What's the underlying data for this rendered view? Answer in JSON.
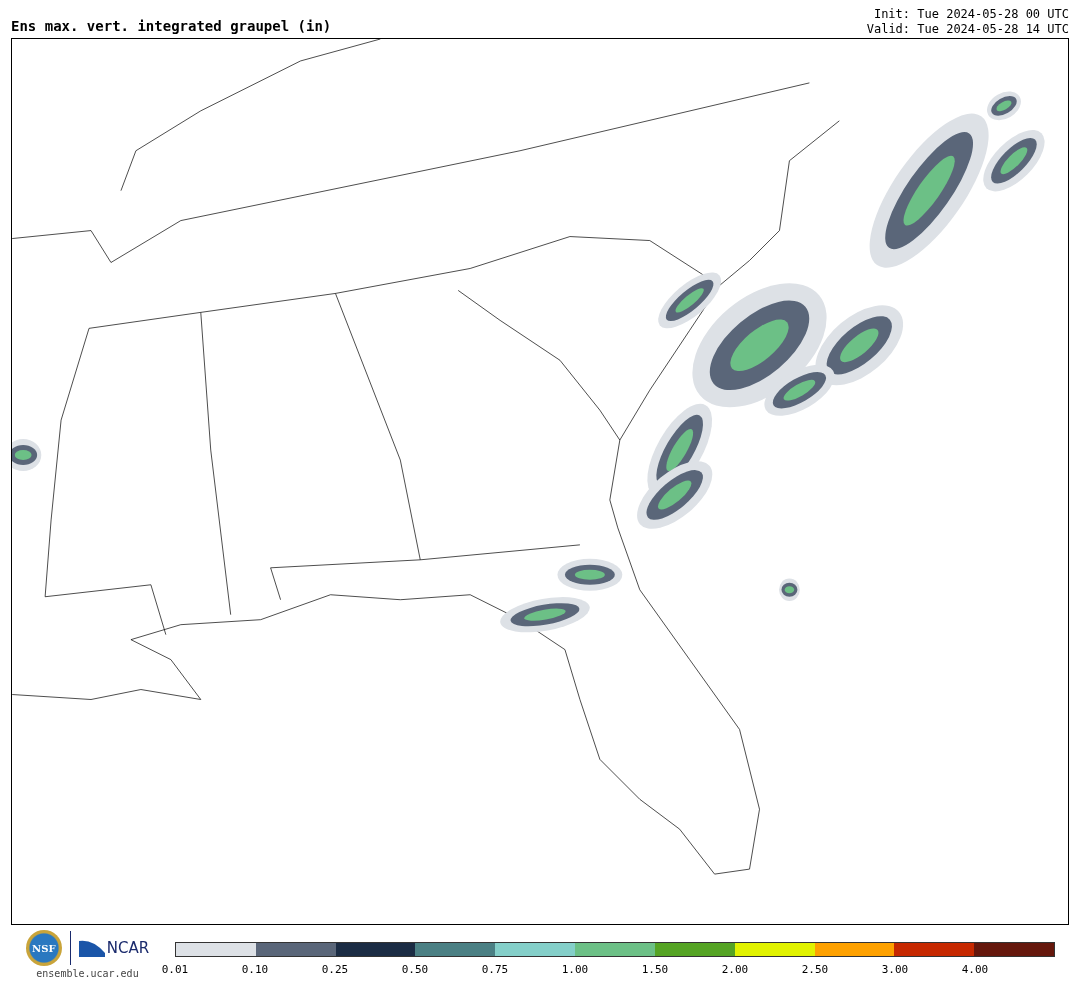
{
  "title": "Ens max. vert. integrated graupel (in)",
  "init": "Init: Tue 2024-05-28 00 UTC",
  "valid": "Valid: Tue 2024-05-28 14 UTC",
  "logos": {
    "nsf": "NSF",
    "ncar": "NCAR",
    "site": "ensemble.ucar.edu"
  },
  "colorbar": {
    "segments": [
      {
        "color": "#dde1e6"
      },
      {
        "color": "#5a6679"
      },
      {
        "color": "#1b2c44"
      },
      {
        "color": "#4b8084"
      },
      {
        "color": "#84cfc9"
      },
      {
        "color": "#6cc086"
      },
      {
        "color": "#55a424"
      },
      {
        "color": "#e1f200"
      },
      {
        "color": "#fea100"
      },
      {
        "color": "#c62800"
      },
      {
        "color": "#65170c"
      }
    ],
    "ticks": [
      "0.01",
      "0.10",
      "0.25",
      "0.50",
      "0.75",
      "1.00",
      "1.50",
      "2.00",
      "2.50",
      "3.00",
      "4.00"
    ]
  }
}
